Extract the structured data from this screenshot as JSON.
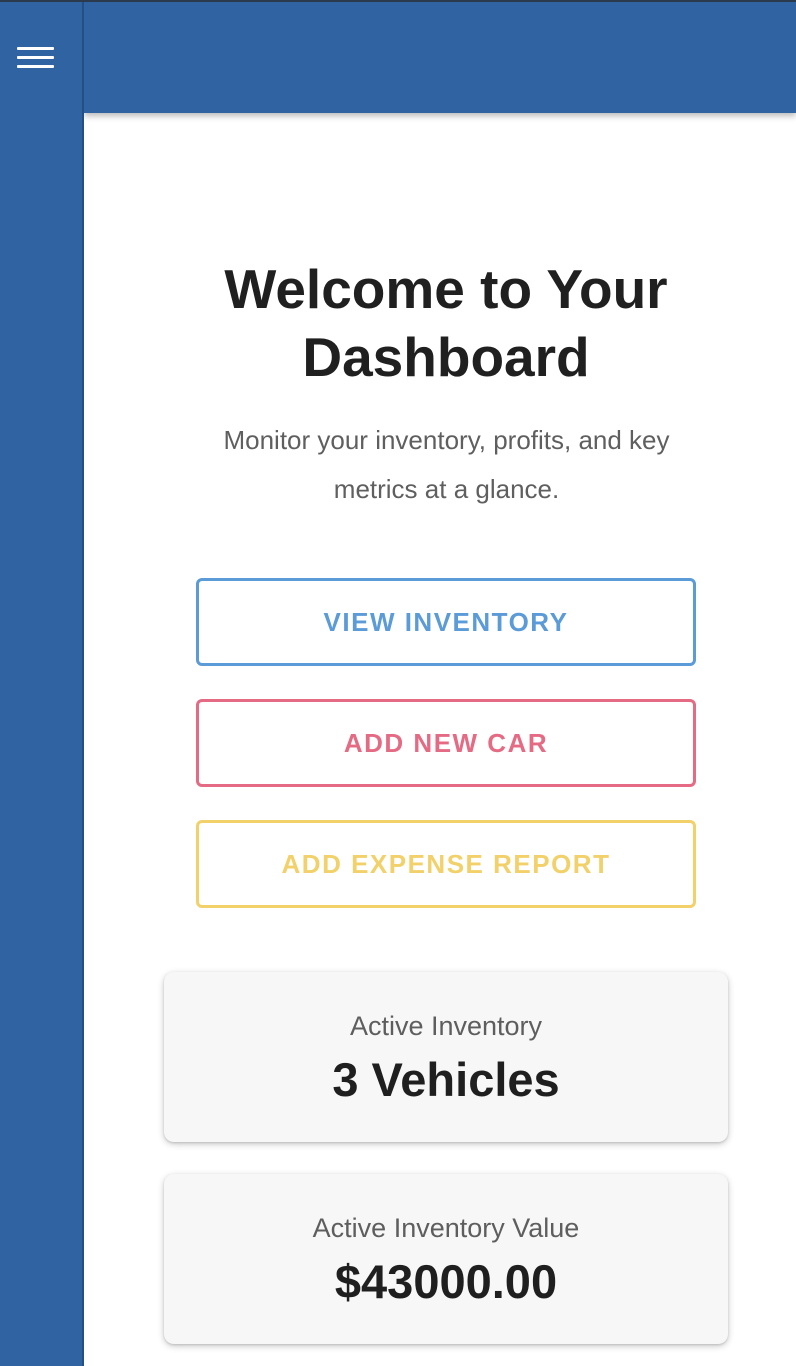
{
  "colors": {
    "primary": "#2f63a2",
    "view_inventory": "#5b9bd8",
    "add_new_car": "#e56b84",
    "add_expense_report": "#f2d06a"
  },
  "sidebar": {
    "menu_icon": "hamburger-menu-icon"
  },
  "main": {
    "title": "Welcome to Your Dashboard",
    "subtitle": "Monitor your inventory, profits, and key metrics at a glance.",
    "actions": [
      {
        "label": "VIEW INVENTORY"
      },
      {
        "label": "ADD NEW CAR"
      },
      {
        "label": "ADD EXPENSE REPORT"
      }
    ],
    "stats": [
      {
        "label": "Active Inventory",
        "value": "3 Vehicles"
      },
      {
        "label": "Active Inventory Value",
        "value": "$43000.00"
      }
    ]
  }
}
